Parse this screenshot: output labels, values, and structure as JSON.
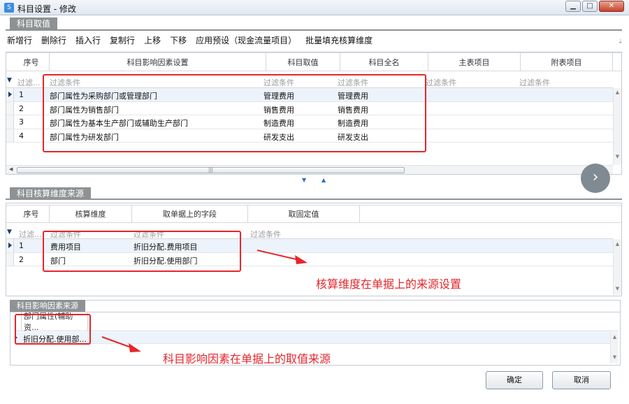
{
  "window": {
    "title": "科目设置 - 修改",
    "app_icon": "S"
  },
  "section1": {
    "tab": "科目取值",
    "toolbar": [
      "新增行",
      "删除行",
      "插入行",
      "复制行",
      "上移",
      "下移",
      "应用预设（现金流量项目）",
      "批量填充核算维度"
    ],
    "columns": [
      "序号",
      "科目影响因素设置",
      "科目取值",
      "科目全名",
      "主表项目",
      "附表项目"
    ],
    "filter_row": [
      "过滤...",
      "过滤条件",
      "过滤条件",
      "过滤条件",
      "过滤条件",
      "过滤条件"
    ],
    "rows": [
      {
        "no": "1",
        "factor": "部门属性为采购部门或管理部门",
        "value": "管理费用",
        "fullname": "管理费用"
      },
      {
        "no": "2",
        "factor": "部门属性为销售部门",
        "value": "销售费用",
        "fullname": "销售费用"
      },
      {
        "no": "3",
        "factor": "部门属性为基本生产部门或辅助生产部门",
        "value": "制造费用",
        "fullname": "制造费用"
      },
      {
        "no": "4",
        "factor": "部门属性为研发部门",
        "value": "研发支出",
        "fullname": "研发支出"
      }
    ]
  },
  "section2": {
    "tab": "科目核算维度来源",
    "columns": [
      "序号",
      "核算维度",
      "取单据上的字段",
      "取固定值"
    ],
    "filter_row": [
      "过滤...",
      "过滤条件",
      "过滤条件",
      "过滤条件"
    ],
    "rows": [
      {
        "no": "1",
        "dim": "费用项目",
        "field": "折旧分配.费用项目"
      },
      {
        "no": "2",
        "dim": "部门",
        "field": "折旧分配.使用部门"
      }
    ]
  },
  "section3": {
    "tab": "科目影响因素来源",
    "column": "部门属性(辅助资...",
    "row_value": "折旧分配.使用部..."
  },
  "annotations": {
    "a1": "核算维度在单据上的来源设置",
    "a2": "科目影响因素在单据上的取值来源"
  },
  "buttons": {
    "ok": "确定",
    "cancel": "取消"
  },
  "colors": {
    "annotation": "#e5262b",
    "tab": "#8e9294"
  }
}
